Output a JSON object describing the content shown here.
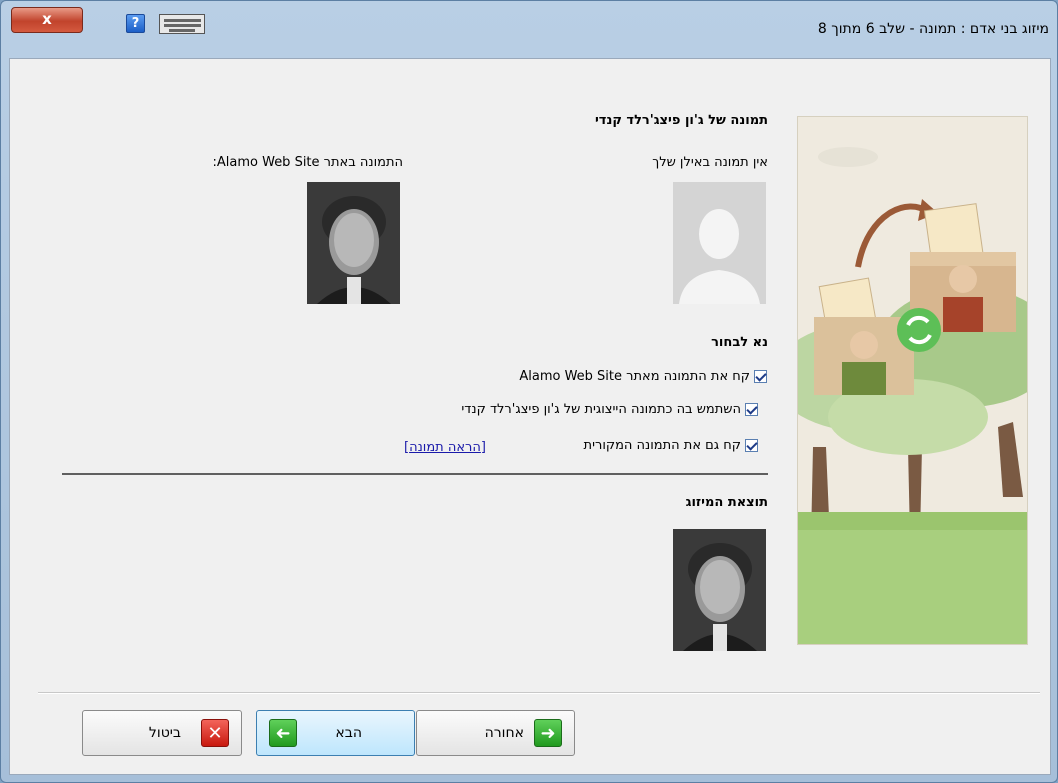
{
  "window": {
    "title": "מיזוג בני אדם : תמונה -  שלב 6 מתוך 8",
    "close_label": "x",
    "help_label": "?"
  },
  "content": {
    "person_heading": "תמונה של ג'ון פיצג'רלד קנדי",
    "left_source_label": "התמונה באתר Alamo Web Site:",
    "right_source_label": "אין תמונה באילן שלך",
    "choose_heading": "נא לבחור",
    "options": [
      {
        "label": "קח את התמונה מאתר Alamo Web Site",
        "checked": true
      },
      {
        "label": "השתמש בה כתמונה הייצוגית של ג'ון פיצג'רלד קנדי",
        "checked": true
      },
      {
        "label": "קח גם את התמונה המקורית",
        "checked": true
      }
    ],
    "view_photo_link": "[הראה תמונה]",
    "result_heading": "תוצאת המיזוג"
  },
  "buttons": {
    "back": "אחורה",
    "next": "הבא",
    "cancel": "ביטול"
  },
  "icons": {
    "help": "help-icon",
    "keyboard": "keyboard-icon",
    "back": "arrow-right-icon",
    "next": "arrow-left-icon",
    "cancel": "x-icon",
    "sync": "sync-icon"
  },
  "colors": {
    "accent_green": "#3fb13a",
    "cancel_red": "#d9251b",
    "link": "#1a1aaa"
  }
}
